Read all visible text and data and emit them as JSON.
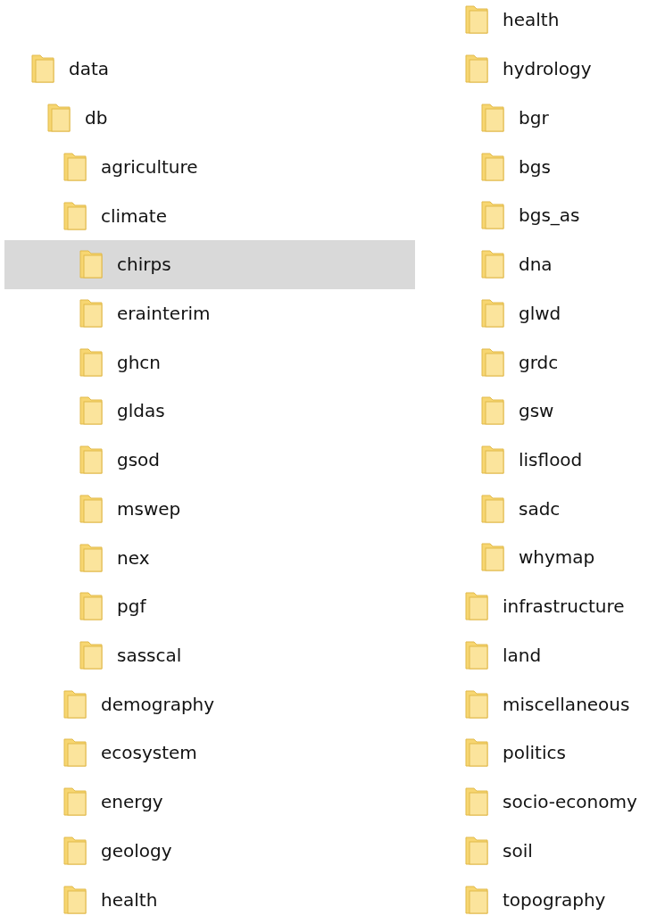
{
  "left_column": [
    {
      "label": "data",
      "selected": false,
      "children": [
        {
          "label": "db",
          "selected": false,
          "children": [
            {
              "label": "agriculture",
              "selected": false
            },
            {
              "label": "climate",
              "selected": false,
              "children": [
                {
                  "label": "chirps",
                  "selected": true
                },
                {
                  "label": "erainterim",
                  "selected": false
                },
                {
                  "label": "ghcn",
                  "selected": false
                },
                {
                  "label": "gldas",
                  "selected": false
                },
                {
                  "label": "gsod",
                  "selected": false
                },
                {
                  "label": "mswep",
                  "selected": false
                },
                {
                  "label": "nex",
                  "selected": false
                },
                {
                  "label": "pgf",
                  "selected": false
                },
                {
                  "label": "sasscal",
                  "selected": false
                }
              ]
            },
            {
              "label": "demography",
              "selected": false
            },
            {
              "label": "ecosystem",
              "selected": false
            },
            {
              "label": "energy",
              "selected": false
            },
            {
              "label": "geology",
              "selected": false
            },
            {
              "label": "health",
              "selected": false
            }
          ]
        }
      ]
    }
  ],
  "right_column": [
    {
      "label": "health",
      "selected": false
    },
    {
      "label": "hydrology",
      "selected": false,
      "children": [
        {
          "label": "bgr",
          "selected": false
        },
        {
          "label": "bgs",
          "selected": false
        },
        {
          "label": "bgs_as",
          "selected": false
        },
        {
          "label": "dna",
          "selected": false
        },
        {
          "label": "glwd",
          "selected": false
        },
        {
          "label": "grdc",
          "selected": false
        },
        {
          "label": "gsw",
          "selected": false
        },
        {
          "label": "lisflood",
          "selected": false
        },
        {
          "label": "sadc",
          "selected": false
        },
        {
          "label": "whymap",
          "selected": false
        }
      ]
    },
    {
      "label": "infrastructure",
      "selected": false
    },
    {
      "label": "land",
      "selected": false
    },
    {
      "label": "miscellaneous",
      "selected": false
    },
    {
      "label": "politics",
      "selected": false
    },
    {
      "label": "socio-economy",
      "selected": false
    },
    {
      "label": "soil",
      "selected": false
    },
    {
      "label": "topography",
      "selected": false
    }
  ]
}
